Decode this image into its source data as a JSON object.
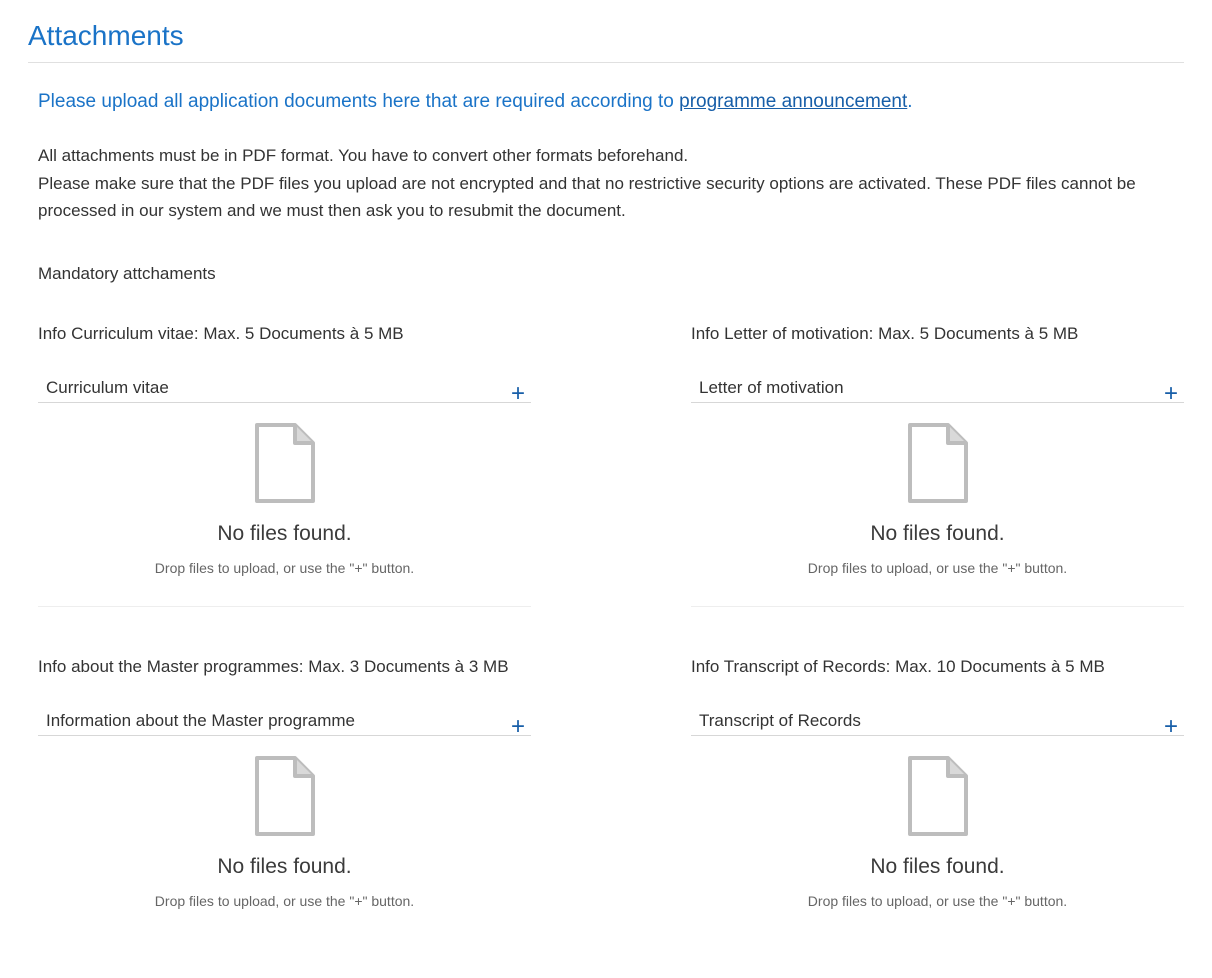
{
  "section_title": "Attachments",
  "instruction": {
    "prefix": "Please upload all application documents here that are required according to ",
    "link": "programme announcement",
    "suffix": "."
  },
  "paragraphs": [
    "All attachments must be in PDF format. You have to convert other formats beforehand.",
    "Please make sure that the PDF files you upload are not encrypted and that no restrictive security options are activated. These PDF files cannot be processed in our system and we must then ask you to resubmit the document."
  ],
  "subheading": "Mandatory attchaments",
  "uploads": [
    {
      "info": "Info Curriculum vitae: Max. 5 Documents à 5 MB",
      "title": "Curriculum vitae",
      "empty": "No files found.",
      "hint": "Drop files to upload, or use the \"+\" button."
    },
    {
      "info": "Info Letter of motivation: Max. 5 Documents à 5 MB",
      "title": "Letter of motivation",
      "empty": "No files found.",
      "hint": "Drop files to upload, or use the \"+\" button."
    },
    {
      "info": "Info about the Master programmes: Max. 3 Documents à 3 MB",
      "title": "Information about the Master programme",
      "empty": "No files found.",
      "hint": "Drop files to upload, or use the \"+\" button."
    },
    {
      "info": "Info Transcript of Records: Max. 10 Documents à 5 MB",
      "title": "Transcript of Records",
      "empty": "No files found.",
      "hint": "Drop files to upload, or use the \"+\" button."
    }
  ]
}
